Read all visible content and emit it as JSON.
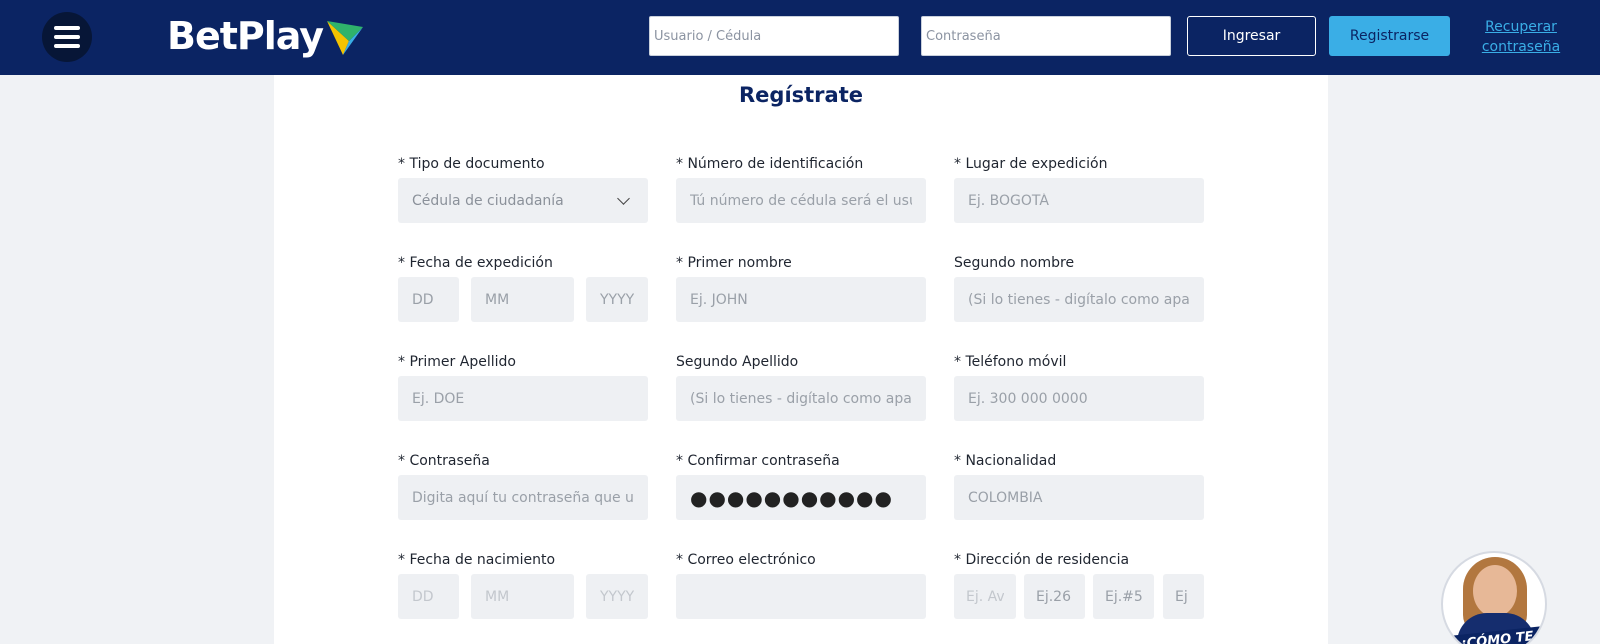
{
  "header": {
    "brand": "BetPlay",
    "user_placeholder": "Usuario / Cédula",
    "password_placeholder": "Contraseña",
    "login_label": "Ingresar",
    "register_label": "Registrarse",
    "recover_line1": "Recuperar",
    "recover_line2": "contraseña",
    "bg_color": "#0b2463",
    "accent_color": "#3aaee6"
  },
  "form": {
    "title": "Regístrate",
    "doc_type": {
      "label": "* Tipo de documento",
      "value": "Cédula de ciudadanía"
    },
    "id_number": {
      "label": "* Número de identificación",
      "placeholder": "Tú número de cédula será el usuario"
    },
    "issue_place": {
      "label": "* Lugar de expedición",
      "placeholder": "Ej. BOGOTÁ"
    },
    "issue_date": {
      "label": "* Fecha de expedición",
      "dd": "DD",
      "mm": "MM",
      "yyyy": "YYYY"
    },
    "first_name": {
      "label": "* Primer nombre",
      "placeholder": "Ej. JOHN"
    },
    "second_name": {
      "label": "Segundo nombre",
      "placeholder": "(Si lo tienes - digítalo como aparece)"
    },
    "first_surname": {
      "label": "* Primer Apellido",
      "placeholder": "Ej. DOE"
    },
    "second_surname": {
      "label": "Segundo Apellido",
      "placeholder": "(Si lo tienes - digítalo como aparece)"
    },
    "mobile": {
      "label": "* Teléfono móvil",
      "placeholder": "Ej. 300 000 0000"
    },
    "password": {
      "label": "* Contraseña",
      "placeholder": "Digita aquí tu contraseña que usarás"
    },
    "confirm_password": {
      "label": "* Confirmar contraseña",
      "value": "●●●●●●●●●●●"
    },
    "nationality": {
      "label": "* Nacionalidad",
      "placeholder": "COLOMBIA"
    },
    "birth_date": {
      "label": "* Fecha de nacimiento",
      "dd": "DD",
      "mm": "MM",
      "yyyy": "YYYY"
    },
    "email": {
      "label": "* Correo electrónico",
      "placeholder": ""
    },
    "address": {
      "label": "* Dirección de residencia",
      "p1": "Ej. Av.",
      "p2": "Ej.26",
      "p3": "Ej.#5",
      "p4": "Ej"
    }
  },
  "helper": {
    "banner": "¿CÓMO TE"
  }
}
